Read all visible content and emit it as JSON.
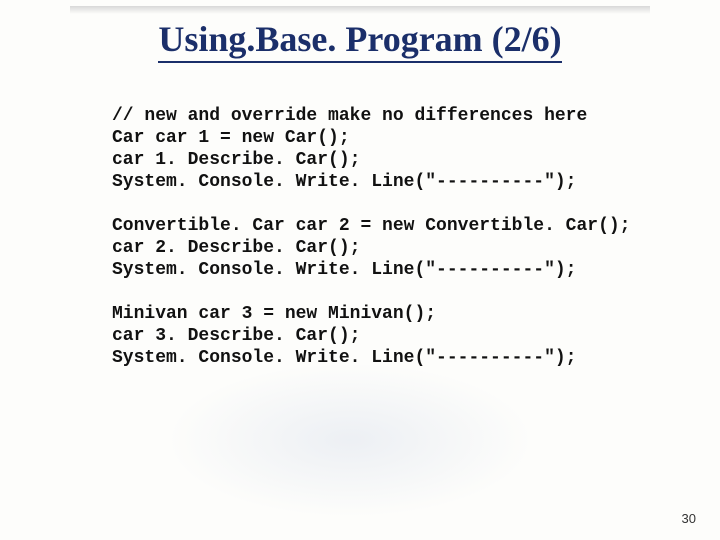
{
  "title": "Using.Base. Program (2/6)",
  "code_block1": "// new and override make no differences here\nCar car 1 = new Car();\ncar 1. Describe. Car();\nSystem. Console. Write. Line(\"----------\");",
  "code_block2": "Convertible. Car car 2 = new Convertible. Car();\ncar 2. Describe. Car();\nSystem. Console. Write. Line(\"----------\");",
  "code_block3": "Minivan car 3 = new Minivan();\ncar 3. Describe. Car();\nSystem. Console. Write. Line(\"----------\");",
  "page_number": "30"
}
